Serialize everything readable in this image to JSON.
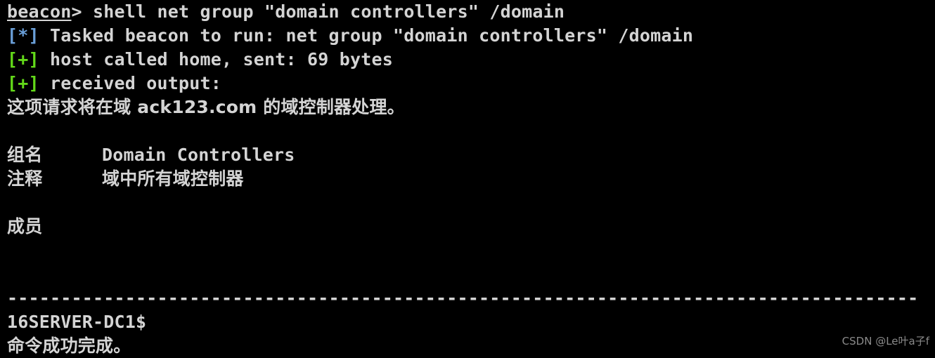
{
  "terminal": {
    "background_color": "#000000",
    "foreground_color": "#d4d4d4",
    "info_tag_color": "#6a9fd8",
    "success_tag_color": "#63d919",
    "prompt": {
      "host": "beacon",
      "arrow": "> ",
      "command": "shell net group \"domain controllers\" /domain"
    },
    "lines": {
      "tasked_tag": "[*]",
      "tasked_text": " Tasked beacon to run: net group \"domain controllers\" /domain",
      "called_home_tag": "[+]",
      "called_home_text": " host called home, sent: 69 bytes",
      "received_tag": "[+]",
      "received_text": " received output:",
      "domain_notice": "这项请求将在域 ack123.com 的域控制器处理。"
    },
    "group_info": {
      "group_name_label": "组名",
      "group_name_value": "Domain Controllers",
      "comment_label": "注释",
      "comment_value": "域中所有域控制器",
      "members_label": "成员"
    },
    "separator": "-------------------------------------------------------------------------------------",
    "members": {
      "entries": [
        "16SERVER-DC1$"
      ],
      "completion_message": "命令成功完成。"
    }
  },
  "watermark": {
    "text": "CSDN @Le叶a子f"
  }
}
